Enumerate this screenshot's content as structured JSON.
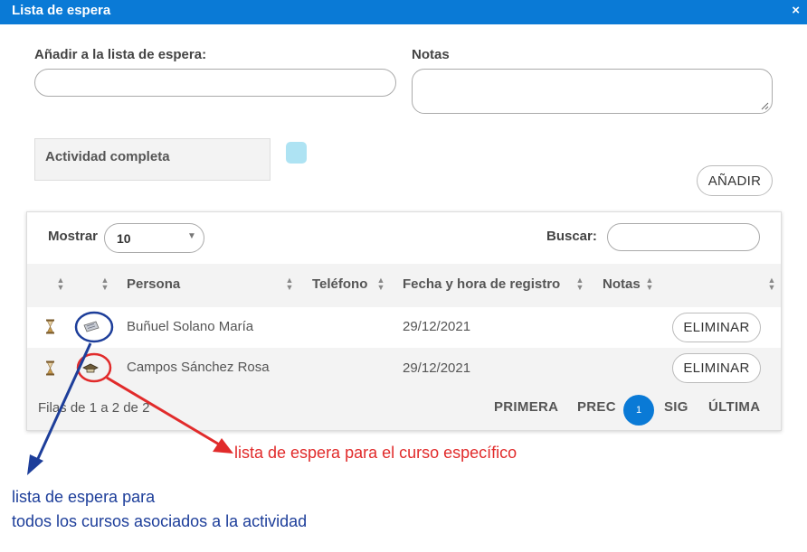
{
  "window": {
    "title": "Lista de espera",
    "close_glyph": "×"
  },
  "form": {
    "add_label": "Añadir a la lista de espera:",
    "add_value": "",
    "notes_label": "Notas",
    "notes_value": "",
    "activity_label": "Actividad completa",
    "activity_color": "#aee3f3",
    "add_button": "AÑADIR"
  },
  "table_controls": {
    "show_label": "Mostrar",
    "page_size": "10",
    "search_label": "Buscar:",
    "search_value": ""
  },
  "table": {
    "columns": [
      "",
      "",
      "Persona",
      "Teléfono",
      "Fecha y hora de registro",
      "Notas",
      ""
    ],
    "rows": [
      {
        "status_icon": "hourglass-icon",
        "scope_icon": "ticket-icon",
        "persona": "Buñuel Solano María",
        "telefono": "",
        "fecha": "29/12/2021",
        "notas": "",
        "action": "ELIMINAR"
      },
      {
        "status_icon": "hourglass-icon",
        "scope_icon": "course-icon",
        "persona": "Campos Sánchez Rosa",
        "telefono": "",
        "fecha": "29/12/2021",
        "notas": "",
        "action": "ELIMINAR"
      }
    ]
  },
  "pagination": {
    "info": "Filas de 1 a 2 de 2",
    "first": "PRIMERA",
    "prev": "PREC",
    "current": "1",
    "next": "SIG",
    "last": "ÚLTIMA"
  },
  "annotations": {
    "red_text": "lista de espera para el curso específico",
    "blue_line1": "lista de espera para",
    "blue_line2": "todos los cursos asociados a la actividad",
    "red_color": "#e12b2b",
    "blue_color": "#1d3e9a"
  },
  "colors": {
    "accent": "#0a7ad6",
    "row_alt": "#f3f3f3"
  }
}
